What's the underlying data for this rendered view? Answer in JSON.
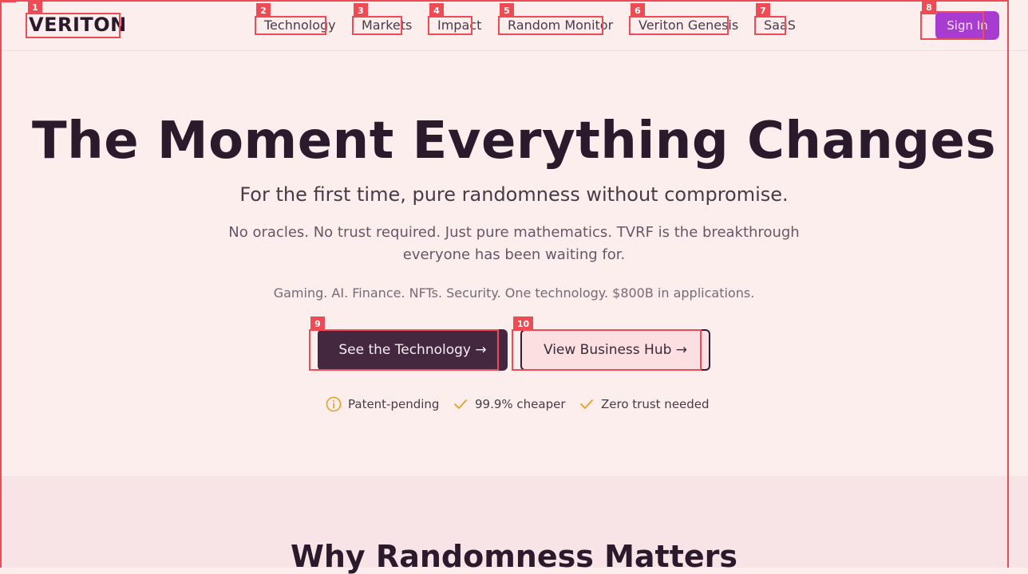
{
  "header": {
    "logo": "VERITON",
    "nav": [
      {
        "label": "Technology"
      },
      {
        "label": "Markets"
      },
      {
        "label": "Impact"
      },
      {
        "label": "Random Monitor"
      },
      {
        "label": "Veriton Genesis"
      },
      {
        "label": "SaaS"
      }
    ],
    "sign_in": "Sign In"
  },
  "hero": {
    "title": "The Moment Everything Changes",
    "subtitle": "For the first time, pure randomness without compromise.",
    "description": "No oracles. No trust required. Just pure mathematics. TVRF is the breakthrough everyone has been waiting for.",
    "applications": "Gaming. AI. Finance. NFTs. Security. One technology. $800B in applications.",
    "primary_button": "See the Technology →",
    "secondary_button": "View Business Hub →",
    "features": [
      {
        "label": "Patent-pending",
        "icon": "info-circle-icon"
      },
      {
        "label": "99.9% cheaper",
        "icon": "check-icon"
      },
      {
        "label": "Zero trust needed",
        "icon": "check-icon"
      }
    ]
  },
  "section2": {
    "title": "Why Randomness Matters"
  },
  "annotations": {
    "tags": [
      "1",
      "2",
      "3",
      "4",
      "5",
      "6",
      "7",
      "8",
      "9",
      "10"
    ]
  },
  "colors": {
    "background": "#fdeeee",
    "accent": "#a93cd0",
    "primary_button": "#43283f",
    "feature_icon": "#e8a021",
    "annotation": "#ef4b55"
  }
}
